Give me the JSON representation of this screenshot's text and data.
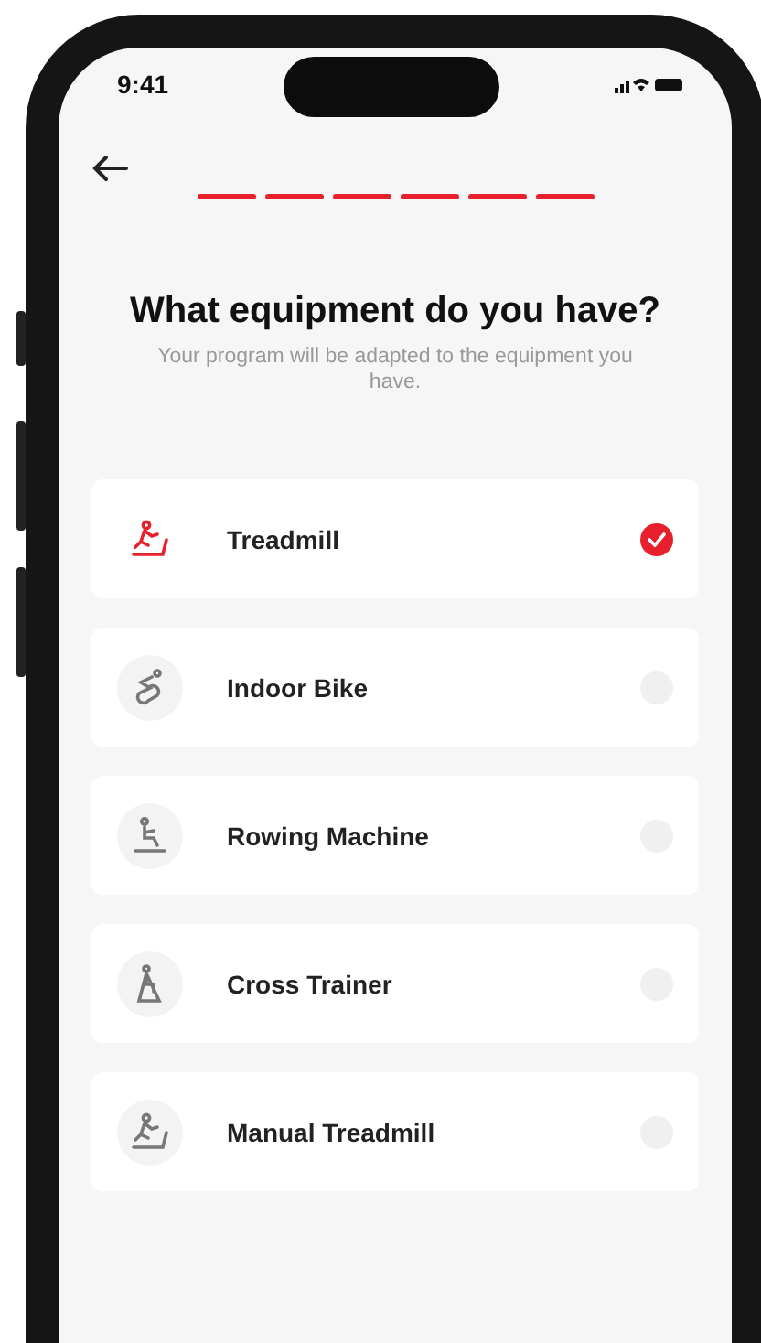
{
  "status_bar": {
    "time": "9:41"
  },
  "progress": [
    {
      "filled": true
    },
    {
      "filled": true
    },
    {
      "filled": true
    },
    {
      "filled": true
    },
    {
      "filled": true
    },
    {
      "filled": true
    }
  ],
  "title": "What equipment do you have?",
  "subtitle": "Your program will be adapted to the equipment you have.",
  "options": [
    {
      "kind": "treadmill",
      "label": "Treadmill",
      "selected": true
    },
    {
      "kind": "bike",
      "label": "Indoor Bike",
      "selected": false
    },
    {
      "kind": "rowing",
      "label": "Rowing Machine",
      "selected": false
    },
    {
      "kind": "cross",
      "label": "Cross Trainer",
      "selected": false
    },
    {
      "kind": "manual",
      "label": "Manual Treadmill",
      "selected": false
    }
  ]
}
